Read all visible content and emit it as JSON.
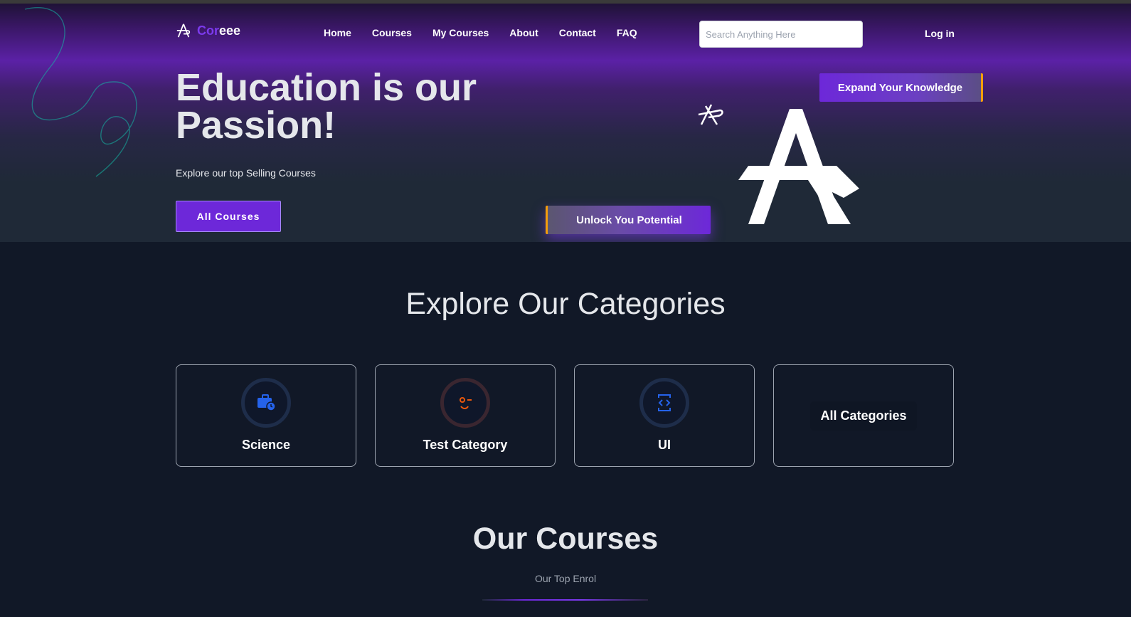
{
  "brand": {
    "name_accent": "Cor",
    "name_rest": "eee",
    "logo_icon": "a-monogram-logo",
    "accent_color": "#7c3aed"
  },
  "nav": {
    "items": [
      {
        "label": "Home"
      },
      {
        "label": "Courses"
      },
      {
        "label": "My Courses"
      },
      {
        "label": "About"
      },
      {
        "label": "Contact"
      },
      {
        "label": "FAQ"
      }
    ],
    "search_placeholder": "Search Anything Here",
    "login_label": "Log in"
  },
  "hero": {
    "title": "Education is our Passion!",
    "subtitle": "Explore our top Selling Courses",
    "all_courses_button": "All Courses",
    "expand_button": "Expand Your Knowledge",
    "unlock_button": "Unlock You Potential",
    "highlight_color": "#f59e0b"
  },
  "categories": {
    "title": "Explore Our Categories",
    "items": [
      {
        "label": "Science",
        "icon": "briefcase-clock-icon"
      },
      {
        "label": "Test Category",
        "icon": "face-icon"
      },
      {
        "label": "UI",
        "icon": "code-device-icon"
      }
    ],
    "all_label": "All Categories"
  },
  "courses": {
    "title": "Our Courses",
    "subtitle": "Our Top Enrol"
  }
}
